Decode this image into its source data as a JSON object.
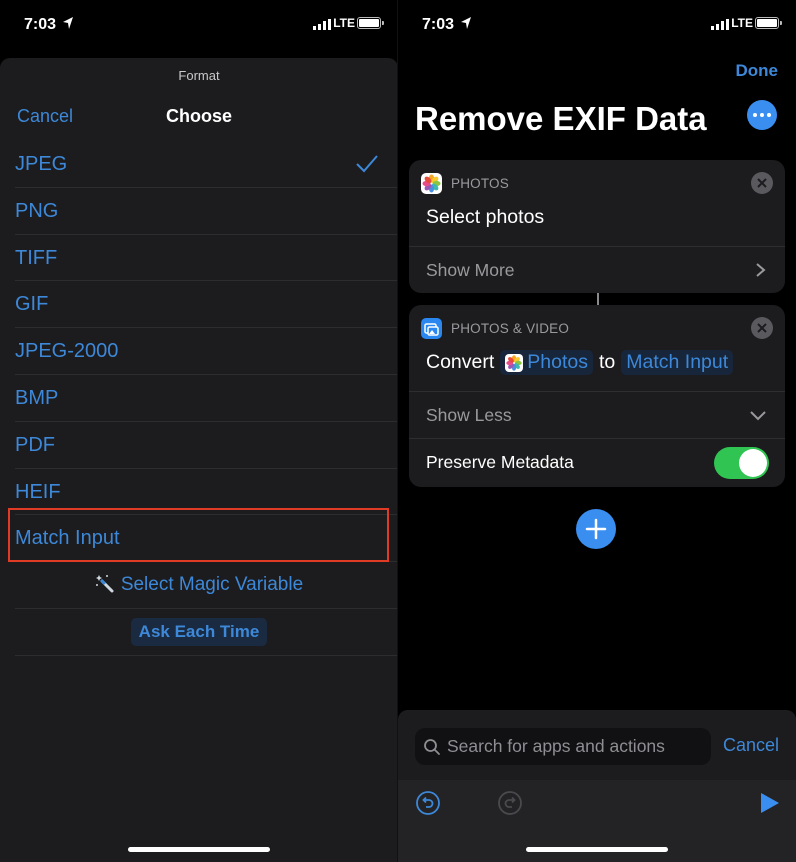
{
  "status_bar": {
    "time": "7:03",
    "carrier": "LTE"
  },
  "left": {
    "sheet_subtitle": "Format",
    "cancel_label": "Cancel",
    "title": "Choose",
    "options": [
      {
        "label": "JPEG",
        "selected": true
      },
      {
        "label": "PNG",
        "selected": false
      },
      {
        "label": "TIFF",
        "selected": false
      },
      {
        "label": "GIF",
        "selected": false
      },
      {
        "label": "JPEG-2000",
        "selected": false
      },
      {
        "label": "BMP",
        "selected": false
      },
      {
        "label": "PDF",
        "selected": false
      },
      {
        "label": "HEIF",
        "selected": false
      },
      {
        "label": "Match Input",
        "selected": false,
        "highlighted": true
      }
    ],
    "magic_variable_label": "Select Magic Variable",
    "ask_each_time_label": "Ask Each Time"
  },
  "right": {
    "done_label": "Done",
    "title": "Remove EXIF Data",
    "more_icon": "ellipsis-icon",
    "actions": [
      {
        "category": "PHOTOS",
        "icon": "photos-app-icon",
        "main_text": "Select photos",
        "expand_label": "Show More"
      },
      {
        "category": "PHOTOS & VIDEO",
        "icon": "photos-video-icon",
        "verb": "Convert",
        "input_token": "Photos",
        "connector_word": "to",
        "format_token": "Match Input",
        "collapse_label": "Show Less",
        "option_label": "Preserve Metadata",
        "option_enabled": true
      }
    ],
    "search": {
      "placeholder": "Search for apps and actions",
      "value": "",
      "cancel_label": "Cancel"
    }
  },
  "colors": {
    "accent": "#3d88d8",
    "button_blue": "#3a8ef0",
    "toggle_on": "#30c552",
    "highlight_red": "#e03b24",
    "sheet_bg": "#1c1c1e"
  }
}
